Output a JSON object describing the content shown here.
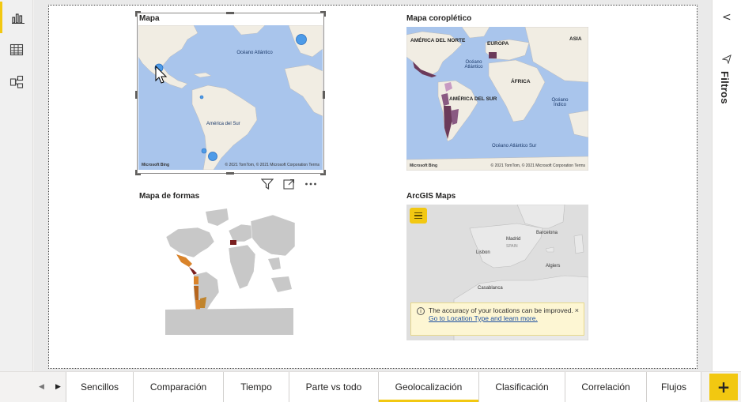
{
  "left_rail": {
    "items": [
      {
        "name": "report-view-icon",
        "active": true
      },
      {
        "name": "data-view-icon",
        "active": false
      },
      {
        "name": "model-view-icon",
        "active": false
      }
    ]
  },
  "visuals": {
    "mapa": {
      "title": "Mapa",
      "labels": {
        "ocean": "Océano Atlántico",
        "south_america": "América del Sur"
      },
      "attribution_left": "Microsoft Bing",
      "attribution_right": "© 2021 TomTom, © 2021 Microsoft Corporation  Terms"
    },
    "coropletico": {
      "title": "Mapa coroplético",
      "labels": {
        "north_america": "AMÉRICA DEL NORTE",
        "europe": "EUROPA",
        "asia": "ASIA",
        "ocean_atlantic": "Océano Atlántico",
        "africa": "ÁFRICA",
        "south_america": "AMÉRICA DEL SUR",
        "ocean_indian": "Océano Índico",
        "ocean_south_atlantic": "Océano Atlántico Sur"
      },
      "attribution_left": "Microsoft Bing",
      "attribution_right": "© 2021 TomTom, © 2021 Microsoft Corporation  Terms"
    },
    "formas": {
      "title": "Mapa de formas"
    },
    "arcgis": {
      "title": "ArcGIS Maps",
      "labels": {
        "madrid": "Madrid",
        "spain": "SPAIN",
        "barcelona": "Barcelona",
        "lisbon": "Lisbon",
        "algiers": "Algiers",
        "casablanca": "Casablanca"
      },
      "notice_text": "The accuracy of your locations can be improved.",
      "notice_link": "Go to Location Type and learn more.",
      "notice_close": "×"
    }
  },
  "filters_pane": {
    "label": "Filtros",
    "collapse_glyph": "<"
  },
  "tabs": [
    {
      "label": "Sencillos",
      "active": false
    },
    {
      "label": "Comparación",
      "active": false
    },
    {
      "label": "Tiempo",
      "active": false
    },
    {
      "label": "Parte vs todo",
      "active": false
    },
    {
      "label": "Geolocalización",
      "active": true
    },
    {
      "label": "Clasificación",
      "active": false
    },
    {
      "label": "Correlación",
      "active": false
    },
    {
      "label": "Flujos",
      "active": false
    }
  ],
  "add_page_label": "+",
  "colors": {
    "accent": "#f2c811",
    "ocean": "#a9c5ec",
    "land": "#f1ede3",
    "shape_gray": "#c8c8c8",
    "choropleth": "#6b3a5a",
    "bubble": "#4d9be8"
  }
}
